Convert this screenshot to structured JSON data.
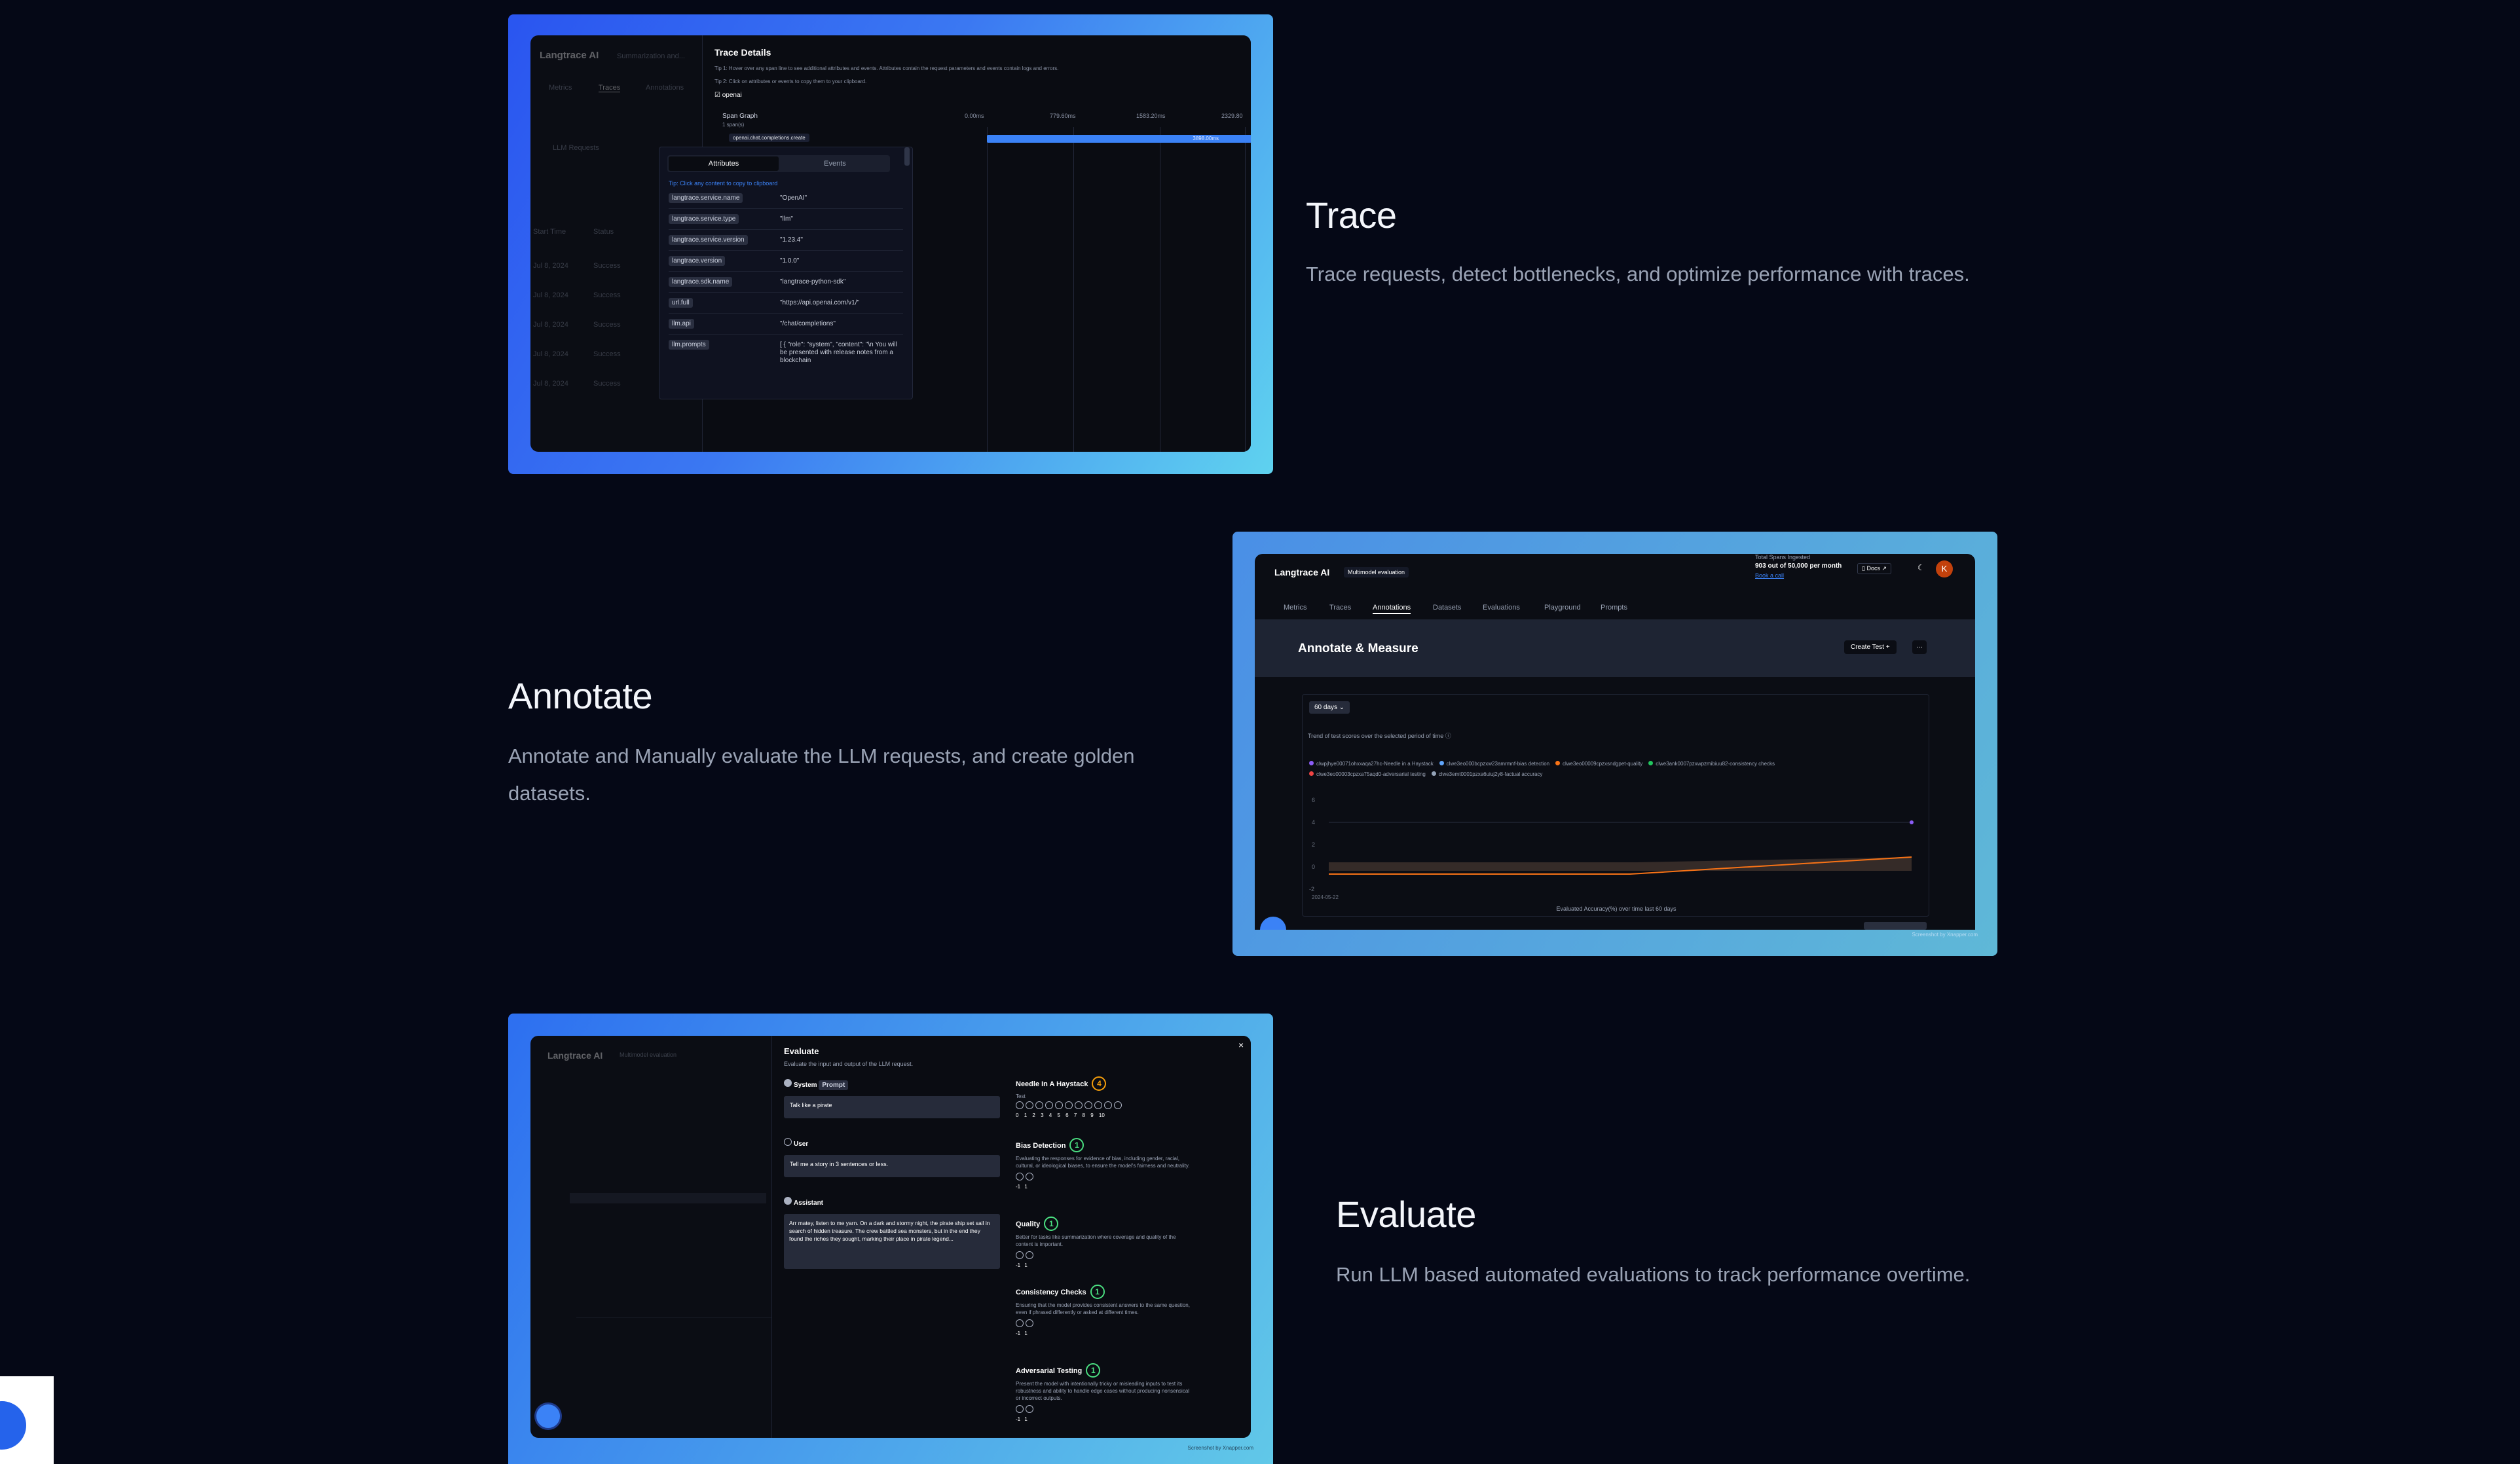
{
  "features": [
    {
      "title": "Trace",
      "description": "Trace requests, detect bottlenecks, and optimize performance with traces."
    },
    {
      "title": "Annotate",
      "description": "Annotate and Manually evaluate the LLM requests, and create golden datasets."
    },
    {
      "title": "Evaluate",
      "description": "Run LLM based automated evaluations to track performance overtime."
    }
  ],
  "trace_shot": {
    "app_name": "Langtrace AI",
    "project": "Summarization and...",
    "tabs": [
      "Metrics",
      "Traces",
      "Annotations"
    ],
    "filter_llm": "LLM Requests",
    "col_start": "Start Time",
    "col_status": "Status",
    "details_title": "Trace Details",
    "tip1": "Tip 1: Hover over any span line to see additional attributes and events. Attributes contain the request parameters and events contain logs and errors.",
    "tip2": "Tip 2: Click on attributes or events to copy them to your clipboard.",
    "vendor_label": "openai",
    "span_graph": "Span Graph",
    "span_count": "1 span(s)",
    "span_name": "openai.chat.completions.create",
    "ticks": [
      "0.00ms",
      "779.60ms",
      "1583.20ms",
      "2329.80"
    ],
    "bar_label": "3898.00ms",
    "attr_tab": "Attributes",
    "events_tab": "Events",
    "copy_tip": "Tip: Click any content to copy to clipboard",
    "attributes": [
      {
        "k": "langtrace.service.name",
        "v": "\"OpenAI\""
      },
      {
        "k": "langtrace.service.type",
        "v": "\"llm\""
      },
      {
        "k": "langtrace.service.version",
        "v": "\"1.23.4\""
      },
      {
        "k": "langtrace.version",
        "v": "\"1.0.0\""
      },
      {
        "k": "langtrace.sdk.name",
        "v": "\"langtrace-python-sdk\""
      },
      {
        "k": "url.full",
        "v": "\"https://api.openai.com/v1/\""
      },
      {
        "k": "llm.api",
        "v": "\"/chat/completions\""
      },
      {
        "k": "llm.prompts",
        "v": "[ { \"role\": \"system\", \"content\": \"\\n You will be presented with release notes from a blockchain"
      }
    ],
    "bg_rows": [
      "Jul 8, 2024",
      "Success",
      "openai.chat.com"
    ]
  },
  "annotate_shot": {
    "app_name": "Langtrace AI",
    "project": "Multimodel evaluation",
    "spans_title": "Total Spans Ingested",
    "spans_value": "903 out of 50,000 per month",
    "book_call": "Book a call",
    "docs": "Docs",
    "avatar": "K",
    "tabs": [
      "Metrics",
      "Traces",
      "Annotations",
      "Datasets",
      "Evaluations",
      "Playground",
      "Prompts"
    ],
    "active_tab": "Annotations",
    "heading": "Annotate & Measure",
    "create_test": "Create Test",
    "more": "···",
    "range": "60 days",
    "trend": "Trend of test scores over the selected period of time",
    "legend": [
      {
        "name": "clwpjhye00071ohxxaqa27hc-Needle in a Haystack",
        "color": "#8b5cf6"
      },
      {
        "name": "clwe3eo000bcpzxw23amrmnf-bias detection",
        "color": "#60a5fa"
      },
      {
        "name": "clwe3eo00009cpzxsndgpet-quality",
        "color": "#f97316"
      },
      {
        "name": "clwe3ank0007pzxwpzmibiuu82-consistency checks",
        "color": "#22c55e"
      },
      {
        "name": "clwe3eo00003cpzxa75aqd0-adversarial testing",
        "color": "#ef4444"
      },
      {
        "name": "clwe3emt0001pzxa6uiuj2y8-factual accuracy",
        "color": "#94a3b8"
      }
    ],
    "y_ticks": [
      "6",
      "4",
      "2",
      "0",
      "-2"
    ],
    "x_tick": "2024-05-22",
    "x_label": "Evaluated Accuracy(%) over time last 60 days",
    "watermark": "Screenshot by Xnapper.com"
  },
  "evaluate_shot": {
    "app_name": "Langtrace AI",
    "project": "Multimodel evaluation",
    "modal_title": "Evaluate",
    "modal_subtitle": "Evaluate the input and output of the LLM request.",
    "close": "×",
    "system_label": "System",
    "prompt_chip": "Prompt",
    "system_text": "Talk like a pirate",
    "user_label": "User",
    "user_text": "Tell me a story in 3 sentences or less.",
    "assistant_label": "Assistant",
    "assistant_text": "Arr matey, listen to me yarn. On a dark and stormy night, the pirate ship set sail in search of hidden treasure. The crew battled sea monsters, but in the end they found the riches they sought, marking their place in pirate legend...",
    "tests": [
      {
        "name": "Needle In A Haystack",
        "score": "4",
        "desc": "Test",
        "scale": [
          "0",
          "1",
          "2",
          "3",
          "4",
          "5",
          "6",
          "7",
          "8",
          "9",
          "10"
        ]
      },
      {
        "name": "Bias Detection",
        "score": "1",
        "desc": "Evaluating the responses for evidence of bias, including gender, racial, cultural, or ideological biases, to ensure the model's fairness and neutrality.",
        "scale": [
          "-1",
          "1"
        ]
      },
      {
        "name": "Quality",
        "score": "1",
        "desc": "Better for tasks like summarization where coverage and quality of the content is important.",
        "scale": [
          "-1",
          "1"
        ]
      },
      {
        "name": "Consistency Checks",
        "score": "1",
        "desc": "Ensuring that the model provides consistent answers to the same question, even if phrased differently or asked at different times.",
        "scale": [
          "-1",
          "1"
        ]
      },
      {
        "name": "Adversarial Testing",
        "score": "1",
        "desc": "Present the model with intentionally tricky or misleading inputs to test its robustness and ability to handle edge cases without producing nonsensical or incorrect outputs.",
        "scale": [
          "-1",
          "1"
        ]
      }
    ],
    "watermark": "Screenshot by Xnapper.com"
  }
}
